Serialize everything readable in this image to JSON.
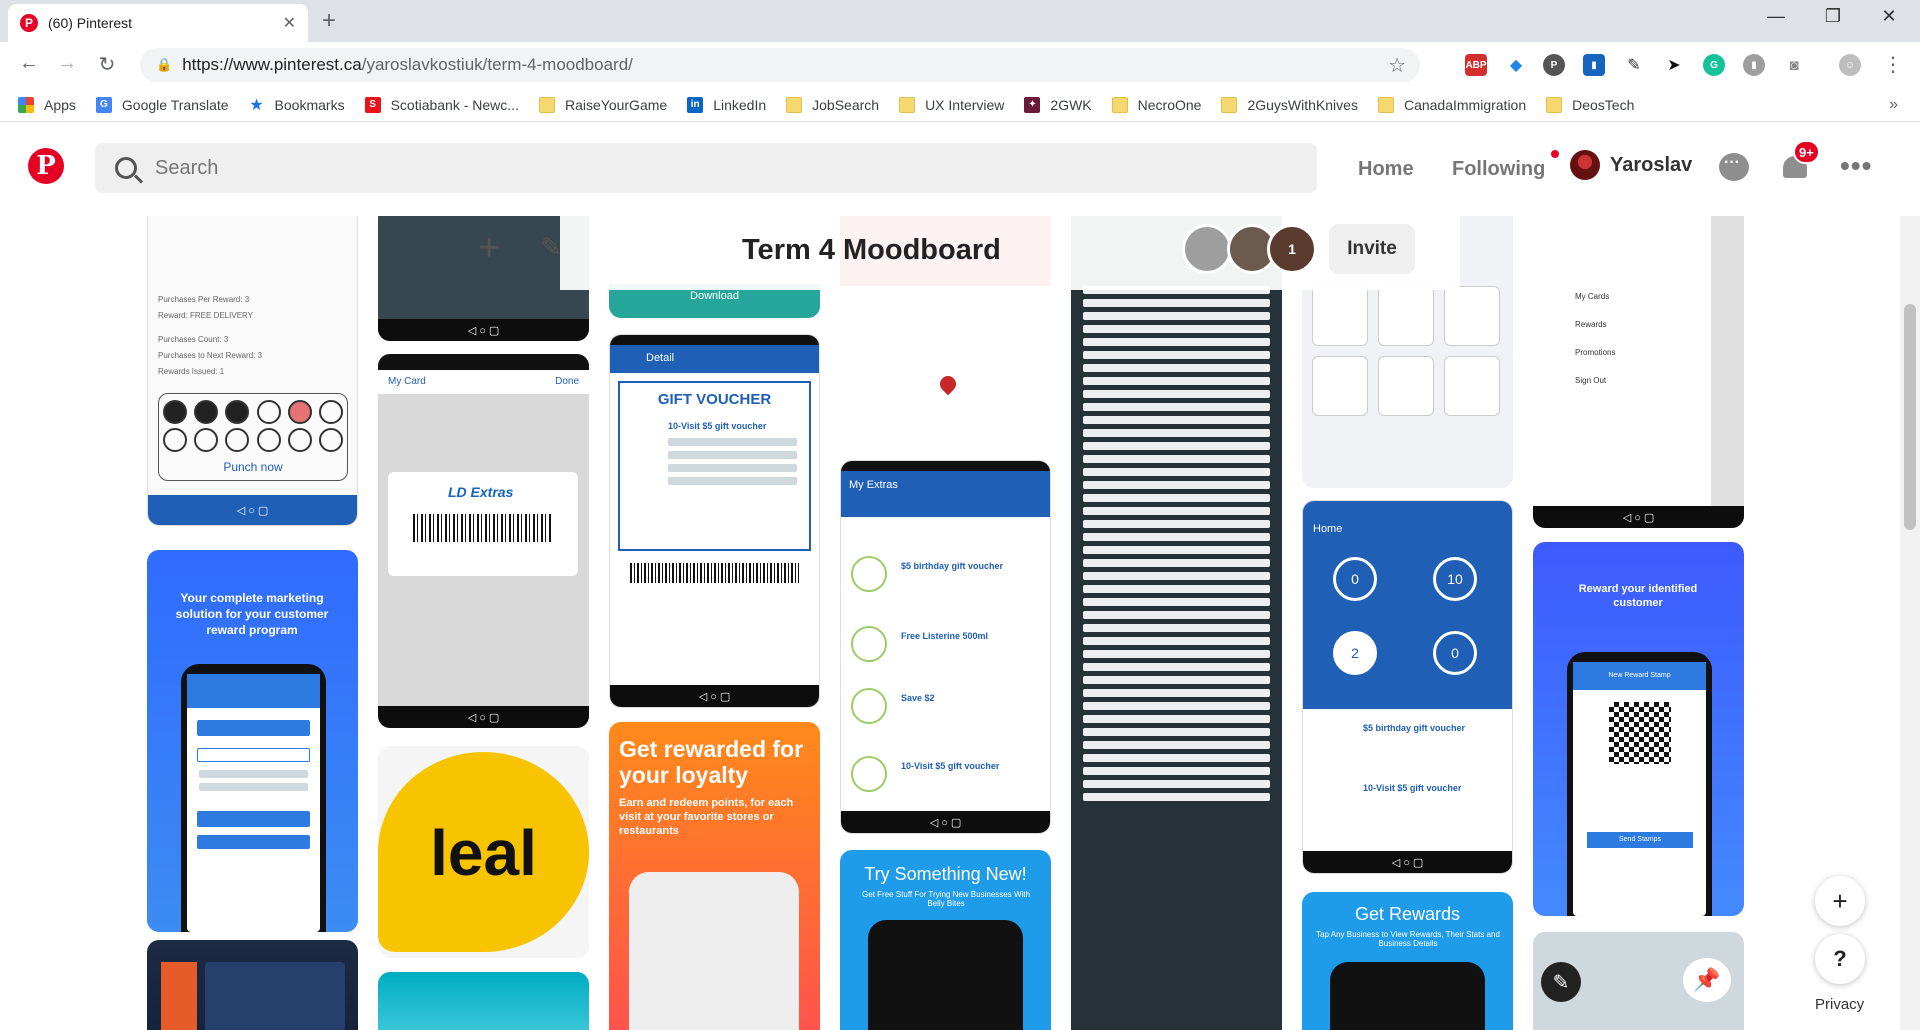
{
  "browser": {
    "tab_title": "(60) Pinterest",
    "tab_close": "✕",
    "new_tab": "+",
    "url_main": "https://www.pinterest.ca",
    "url_path": "/yaroslavkostiuk/term-4-moodboard/",
    "extensions": [
      "abp",
      "dropbox",
      "pinterest",
      "bookmark",
      "eyedropper",
      "cursor",
      "grammarly",
      "stats",
      "camera",
      "avatar"
    ]
  },
  "bookmarks": [
    {
      "label": "Apps",
      "icon": "apps-grid-icon"
    },
    {
      "label": "Google Translate",
      "icon": "google-translate-icon"
    },
    {
      "label": "Bookmarks",
      "icon": "star-icon"
    },
    {
      "label": "Scotiabank - Newc...",
      "icon": "scotiabank-icon"
    },
    {
      "label": "RaiseYourGame",
      "icon": "folder-icon"
    },
    {
      "label": "LinkedIn",
      "icon": "linkedin-icon"
    },
    {
      "label": "JobSearch",
      "icon": "folder-icon"
    },
    {
      "label": "UX Interview",
      "icon": "folder-icon"
    },
    {
      "label": "2GWK",
      "icon": "2gwk-icon"
    },
    {
      "label": "NecroOne",
      "icon": "folder-icon"
    },
    {
      "label": "2GuysWithKnives",
      "icon": "folder-icon"
    },
    {
      "label": "CanadaImmigration",
      "icon": "folder-icon"
    },
    {
      "label": "DeosTech",
      "icon": "folder-icon"
    }
  ],
  "pinterest": {
    "search_placeholder": "Search",
    "nav_home": "Home",
    "nav_following": "Following",
    "user_name": "Yaroslav",
    "notifications_badge": "9+",
    "board_title": "Term 4 Moodboard",
    "invite_label": "Invite",
    "collab_count": "1",
    "privacy_label": "Privacy"
  },
  "pins": {
    "punch_rows": [
      "Purchases Per Reward: 3",
      "Reward: FREE DELIVERY",
      "Purchases Count: 3",
      "Purchases to Next Reward: 3",
      "Rewards Issued: 1"
    ],
    "punch_now": "Punch now",
    "marketing_title": "Your complete marketing solution for your customer reward program",
    "my_card": "My Card",
    "done": "Done",
    "ld_extras": "LD Extras",
    "detail": "Detail",
    "gift_voucher": "GIFT VOUCHER",
    "gift_voucher_sub": "10-Visit $5 gift voucher",
    "download": "Download",
    "get_rewarded": "Get rewarded for your loyalty",
    "get_rewarded_sub": "Earn and redeem points, for each visit at your favorite stores or restaurants",
    "leal": "leal",
    "my_extras": "My Extras",
    "extras_items": [
      "$5 birthday gift voucher",
      "Free Listerine 500ml",
      "Save $2",
      "10-Visit $5 gift voucher"
    ],
    "try_new": "Try Something New!",
    "try_new_sub": "Get Free Stuff For Trying New Businesses With Belly Bites",
    "home": "Home",
    "stats": [
      "0",
      "10",
      "2",
      "0"
    ],
    "voucher_a": "$5 birthday gift voucher",
    "voucher_b": "10-Visit $5 gift voucher",
    "get_rewards": "Get Rewards",
    "get_rewards_sub": "Tap Any Business to View Rewards, Their Stats and Business Details",
    "menu_items": [
      "My Cards",
      "Rewards",
      "Promotions",
      "Sign Out"
    ],
    "reward_identified": "Reward your identified customer",
    "new_reward_stamp": "New Reward Stamp",
    "send_stamps": "Send Stamps"
  }
}
